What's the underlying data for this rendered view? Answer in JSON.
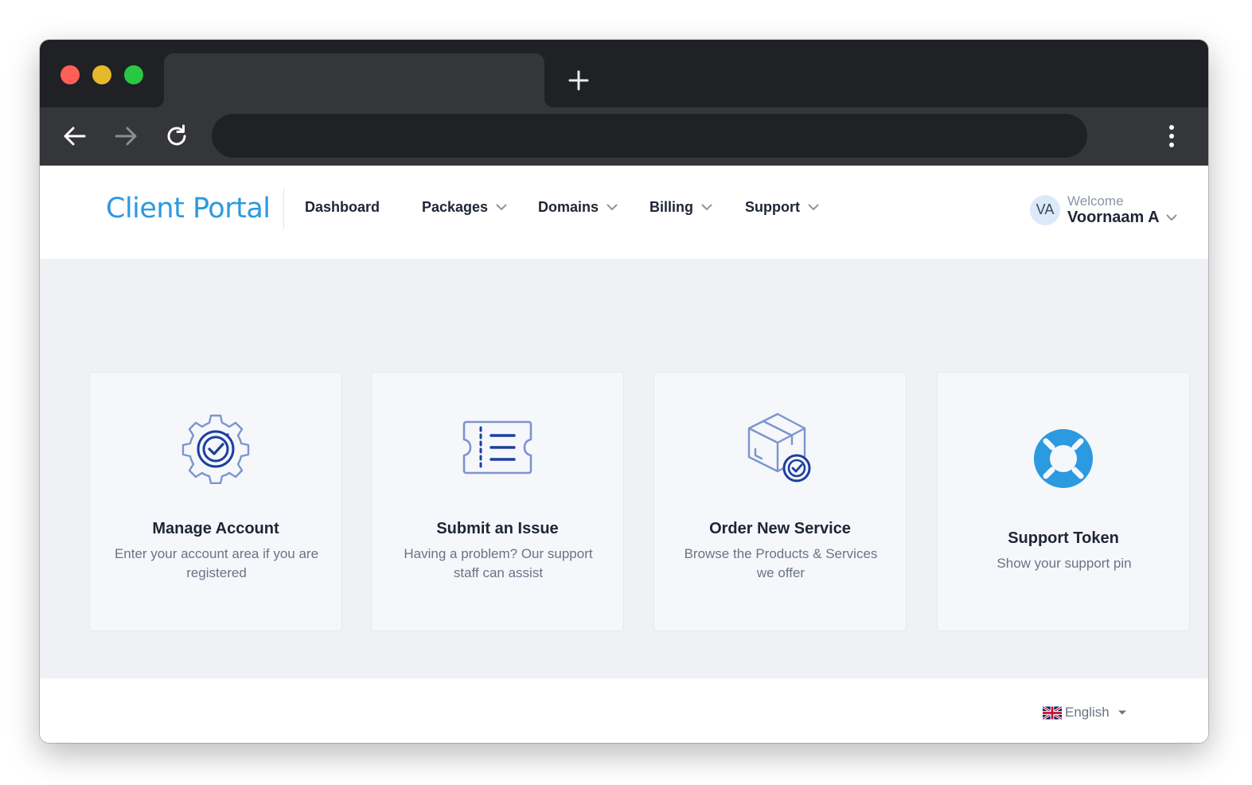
{
  "nav": {
    "brand": "Client Portal",
    "items": [
      {
        "label": "Dashboard",
        "has_dropdown": false
      },
      {
        "label": "Packages",
        "has_dropdown": true
      },
      {
        "label": "Domains",
        "has_dropdown": true
      },
      {
        "label": "Billing",
        "has_dropdown": true
      },
      {
        "label": "Support",
        "has_dropdown": true
      }
    ]
  },
  "user": {
    "initials": "VA",
    "welcome": "Welcome",
    "name": "Voornaam A"
  },
  "cards": [
    {
      "icon": "gear-check-icon",
      "title": "Manage Account",
      "description": "Enter your account area if you are registered"
    },
    {
      "icon": "ticket-list-icon",
      "title": "Submit an Issue",
      "description": "Having a problem? Our support staff can assist"
    },
    {
      "icon": "package-check-icon",
      "title": "Order New Service",
      "description": "Browse the Products & Services we offer"
    },
    {
      "icon": "lifebuoy-icon",
      "title": "Support Token",
      "description": "Show your support pin"
    }
  ],
  "footer": {
    "language": "English",
    "flag_icon": "uk-flag-icon"
  },
  "colors": {
    "brand": "#2b9ae0",
    "icon_blue": "#1c4fb6",
    "icon_light": "#7c94cf",
    "lifebuoy": "#2b9ae0",
    "page_bg": "#eff1f5",
    "browser_dark": "#202124"
  }
}
